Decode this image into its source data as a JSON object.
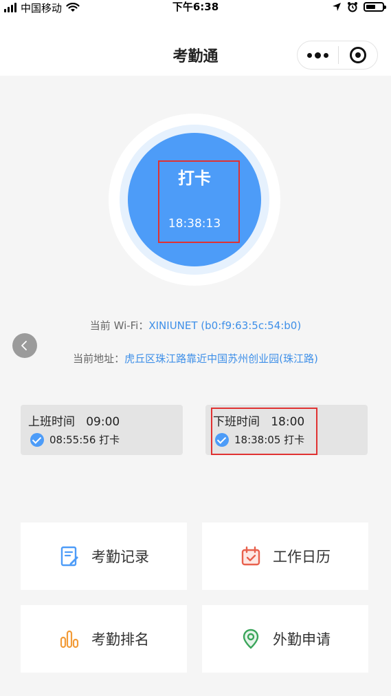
{
  "status_bar": {
    "carrier": "中国移动",
    "time": "下午6:38"
  },
  "nav": {
    "title": "考勤通"
  },
  "punch": {
    "label": "打卡",
    "time": "18:38:13"
  },
  "wifi": {
    "label": "当前 Wi-Fi：",
    "value": "XINIUNET (b0:f9:63:5c:54:b0)"
  },
  "address": {
    "label": "当前地址：",
    "value": "虎丘区珠江路靠近中国苏州创业园(珠江路)"
  },
  "shifts": [
    {
      "title": "上班时间",
      "time": "09:00",
      "record": "08:55:56 打卡"
    },
    {
      "title": "下班时间",
      "time": "18:00",
      "record": "18:38:05 打卡"
    }
  ],
  "menu": [
    {
      "label": "考勤记录",
      "icon": "attendance-record-icon"
    },
    {
      "label": "工作日历",
      "icon": "work-calendar-icon"
    },
    {
      "label": "考勤排名",
      "icon": "attendance-ranking-icon"
    },
    {
      "label": "外勤申请",
      "icon": "field-work-location-icon"
    }
  ],
  "colors": {
    "accent": "#4d9cf8",
    "highlight": "#e03131",
    "link": "#3e8fe8"
  }
}
